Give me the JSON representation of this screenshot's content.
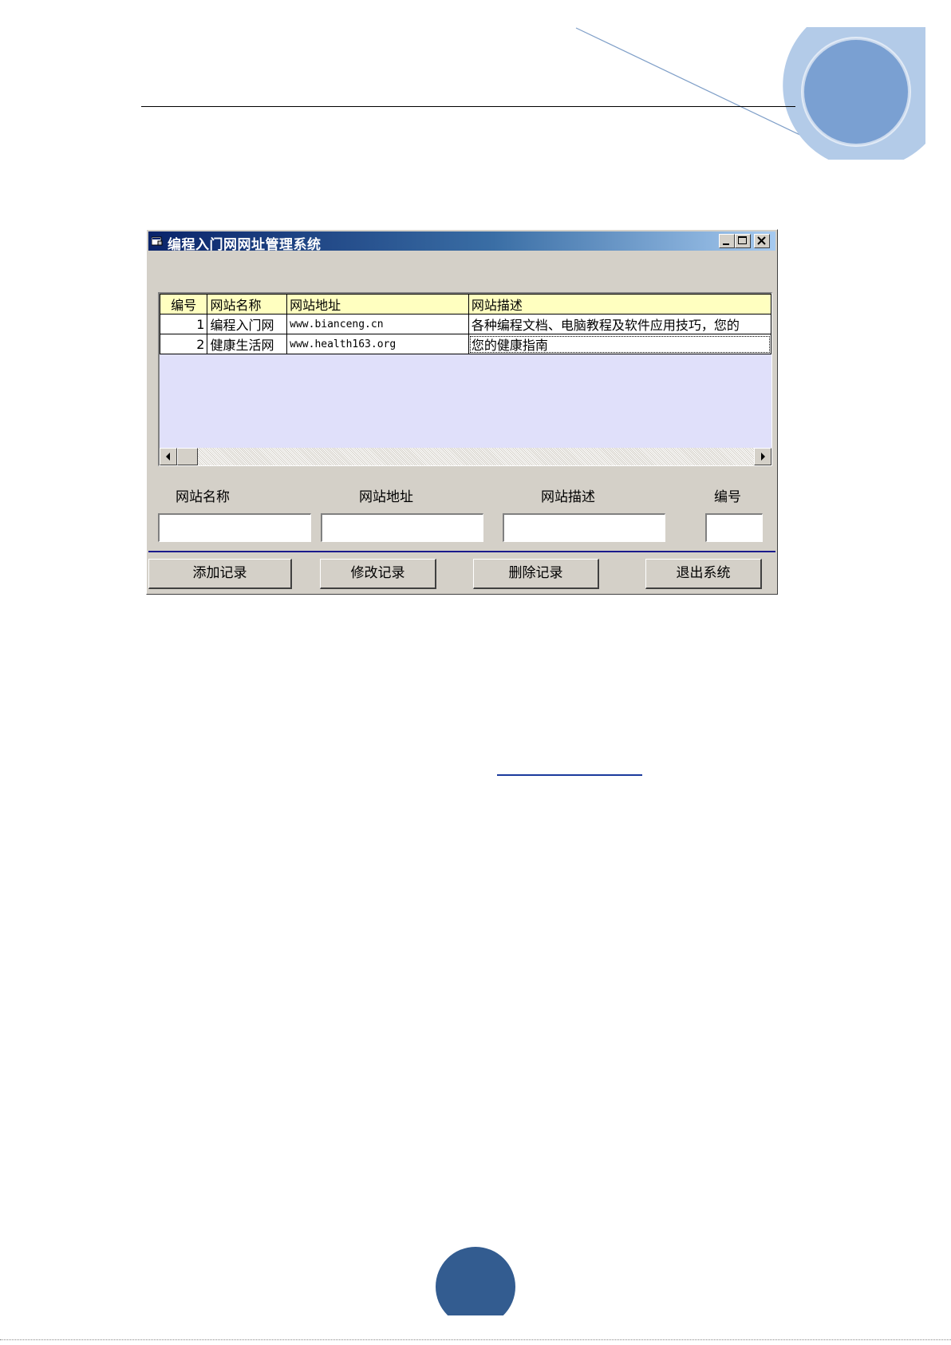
{
  "window": {
    "title": "编程入门网网址管理系统"
  },
  "grid": {
    "columns": [
      "编号",
      "网站名称",
      "网站地址",
      "网站描述"
    ],
    "rows": [
      {
        "id": "1",
        "name": "编程入门网",
        "url": "www.bianceng.cn",
        "desc": "各种编程文档、电脑教程及软件应用技巧，您的"
      },
      {
        "id": "2",
        "name": "健康生活网",
        "url": "www.health163.org",
        "desc": "您的健康指南"
      }
    ]
  },
  "form": {
    "name_label": "网站名称",
    "url_label": "网站地址",
    "desc_label": "网站描述",
    "id_label": "编号",
    "name_value": "",
    "url_value": "",
    "desc_value": "",
    "id_value": ""
  },
  "buttons": {
    "add": "添加记录",
    "edit": "修改记录",
    "delete": "删除记录",
    "exit": "退出系统"
  },
  "colors": {
    "page_circle": "#335c90",
    "deco_outer": "#b3cbe8",
    "deco_inner": "#7aa0d2",
    "grid_background": "#e0e0fa",
    "header_row": "#ffffc0"
  }
}
